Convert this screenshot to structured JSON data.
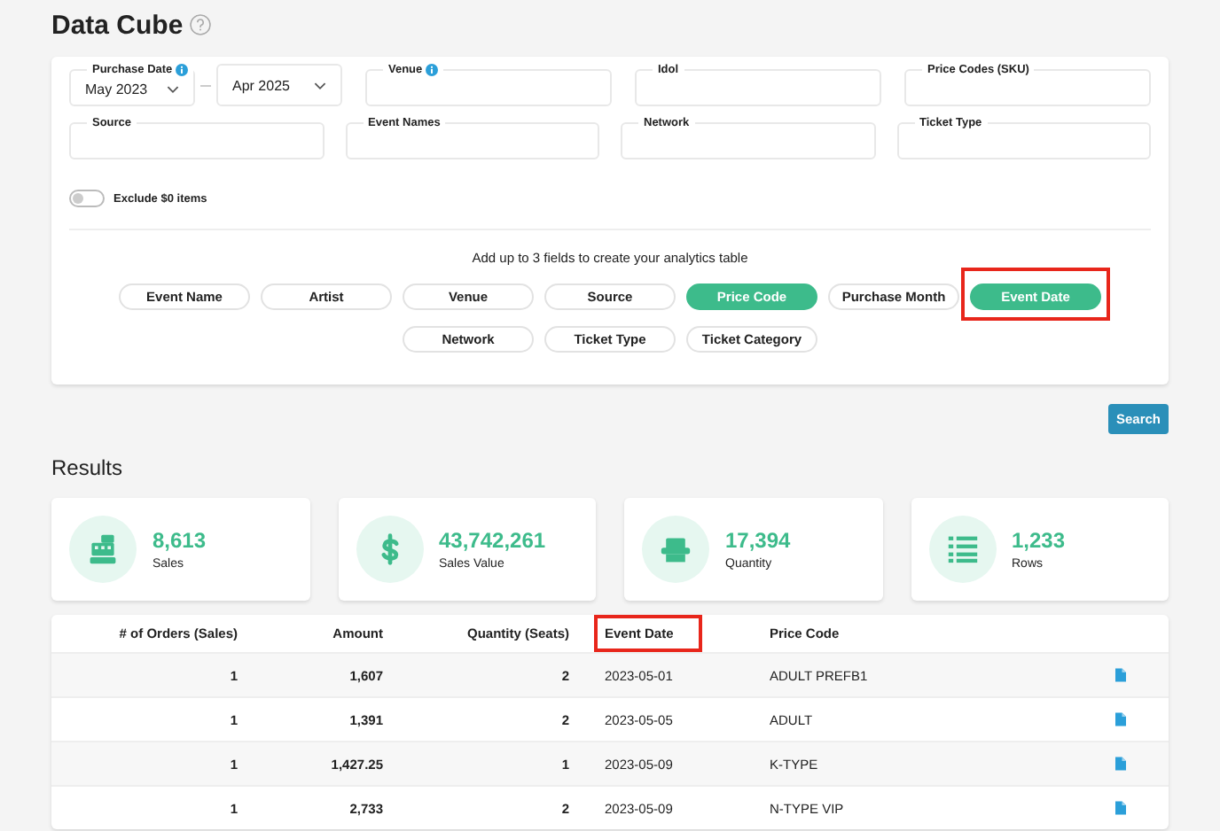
{
  "title": "Data Cube",
  "filters": [
    {
      "kind": "date_range",
      "label": "Purchase Date",
      "info": true,
      "from": "May 2023",
      "to": "Apr 2025"
    },
    {
      "kind": "text",
      "label": "Venue",
      "info": true
    },
    {
      "kind": "text",
      "label": "Idol",
      "info": false
    },
    {
      "kind": "text",
      "label": "Price Codes (SKU)",
      "info": false
    },
    {
      "kind": "text",
      "label": "Source",
      "info": false
    },
    {
      "kind": "text",
      "label": "Event Names",
      "info": false
    },
    {
      "kind": "text",
      "label": "Network",
      "info": false
    },
    {
      "kind": "text",
      "label": "Ticket Type",
      "info": false
    }
  ],
  "exclude_zero": {
    "label": "Exclude $0 items",
    "on": false
  },
  "hint": "Add up to 3 fields to create your analytics table",
  "fields": [
    {
      "label": "Event Name",
      "selected": false,
      "highlighted": false
    },
    {
      "label": "Artist",
      "selected": false,
      "highlighted": false
    },
    {
      "label": "Venue",
      "selected": false,
      "highlighted": false
    },
    {
      "label": "Source",
      "selected": false,
      "highlighted": false
    },
    {
      "label": "Price Code",
      "selected": true,
      "highlighted": false
    },
    {
      "label": "Purchase Month",
      "selected": false,
      "highlighted": false
    },
    {
      "label": "Event Date",
      "selected": true,
      "highlighted": true
    },
    {
      "label": "Network",
      "selected": false,
      "highlighted": false
    },
    {
      "label": "Ticket Type",
      "selected": false,
      "highlighted": false
    },
    {
      "label": "Ticket Category",
      "selected": false,
      "highlighted": false
    }
  ],
  "search_button": "Search",
  "results_title": "Results",
  "stats": [
    {
      "kind": "register",
      "value": "8,613",
      "label": "Sales"
    },
    {
      "kind": "dollar",
      "value": "43,742,261",
      "label": "Sales Value"
    },
    {
      "kind": "seat",
      "value": "17,394",
      "label": "Quantity"
    },
    {
      "kind": "list",
      "value": "1,233",
      "label": "Rows"
    }
  ],
  "table": {
    "columns": [
      {
        "label": "# of Orders (Sales)",
        "highlighted": false
      },
      {
        "label": "Amount",
        "highlighted": false
      },
      {
        "label": "Quantity (Seats)",
        "highlighted": false
      },
      {
        "label": "Event Date",
        "highlighted": true
      },
      {
        "label": "Price Code",
        "highlighted": false
      }
    ],
    "rows": [
      {
        "cells": [
          "1",
          "1,607",
          "2",
          "2023-05-01",
          "ADULT PREFB1"
        ]
      },
      {
        "cells": [
          "1",
          "1,391",
          "2",
          "2023-05-05",
          "ADULT"
        ]
      },
      {
        "cells": [
          "1",
          "1,427.25",
          "1",
          "2023-05-09",
          "K-TYPE"
        ]
      },
      {
        "cells": [
          "1",
          "2,733",
          "2",
          "2023-05-09",
          "N-TYPE VIP"
        ]
      }
    ]
  }
}
